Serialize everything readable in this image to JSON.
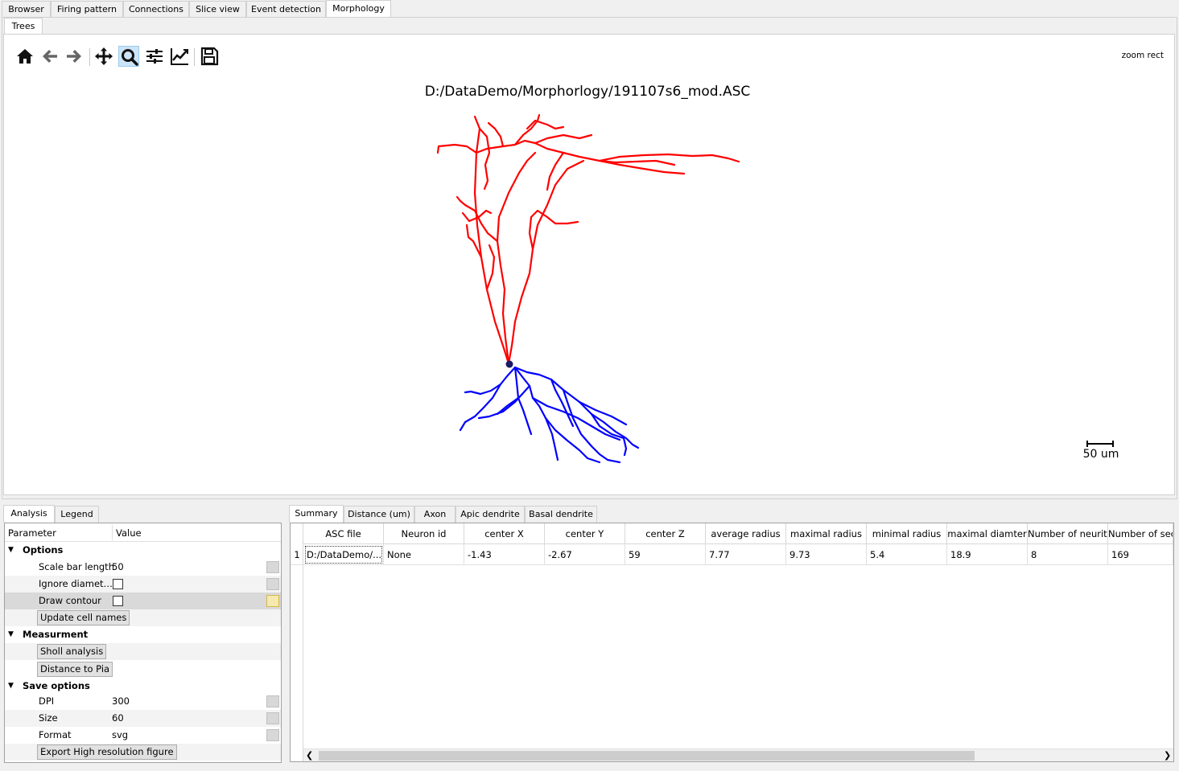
{
  "main_tabs": [
    "Browser",
    "Firing pattern",
    "Connections",
    "Slice view",
    "Event detection",
    "Morphology"
  ],
  "sub_tab": "Trees",
  "toolbar": {
    "icons": [
      "home-icon",
      "back-icon",
      "forward-icon",
      "pan-icon",
      "zoom-icon",
      "configure-subplots-icon",
      "edit-axis-icon",
      "save-icon"
    ],
    "mode_label": "zoom rect"
  },
  "plot": {
    "title": "D:/DataDemo/Morphorlogy/191107s6_mod.ASC",
    "scale_bar_label": "50 um",
    "apical_color": "#ff0000",
    "basal_color": "#0000ff",
    "soma_color": "#1a1a66"
  },
  "left_tabs": [
    "Analysis",
    "Legend"
  ],
  "param_tree": {
    "header_param": "Parameter",
    "header_value": "Value",
    "options_group": "Options",
    "scale_bar_length_label": "Scale bar length",
    "scale_bar_length_value": "50",
    "ignore_diameter_label": "Ignore diamet…",
    "draw_contour_label": "Draw contour",
    "update_cell_names": "Update cell names",
    "measurement_group": "Measurment",
    "sholl_analysis": "Sholl analysis",
    "distance_to_pia": "Distance to Pia",
    "save_group": "Save options",
    "dpi_label": "DPI",
    "dpi_value": "300",
    "size_label": "Size",
    "size_value": "60",
    "format_label": "Format",
    "format_value": "svg",
    "export_button": "Export High resolution figure"
  },
  "right_tabs": [
    "Summary",
    "Distance (um)",
    "Axon",
    "Apic dendrite",
    "Basal dendrite"
  ],
  "table": {
    "columns": [
      "ASC file",
      "Neuron id",
      "center X",
      "center Y",
      "center Z",
      "average radius",
      "maximal radius",
      "minimal radius",
      "maximal diamter",
      "Number of neurite",
      "Number of sect"
    ],
    "row_number": "1",
    "row": [
      "D:/DataDemo/...",
      "None",
      "-1.43",
      "-2.67",
      "59",
      "7.77",
      "9.73",
      "5.4",
      "18.9",
      "8",
      "169"
    ]
  }
}
